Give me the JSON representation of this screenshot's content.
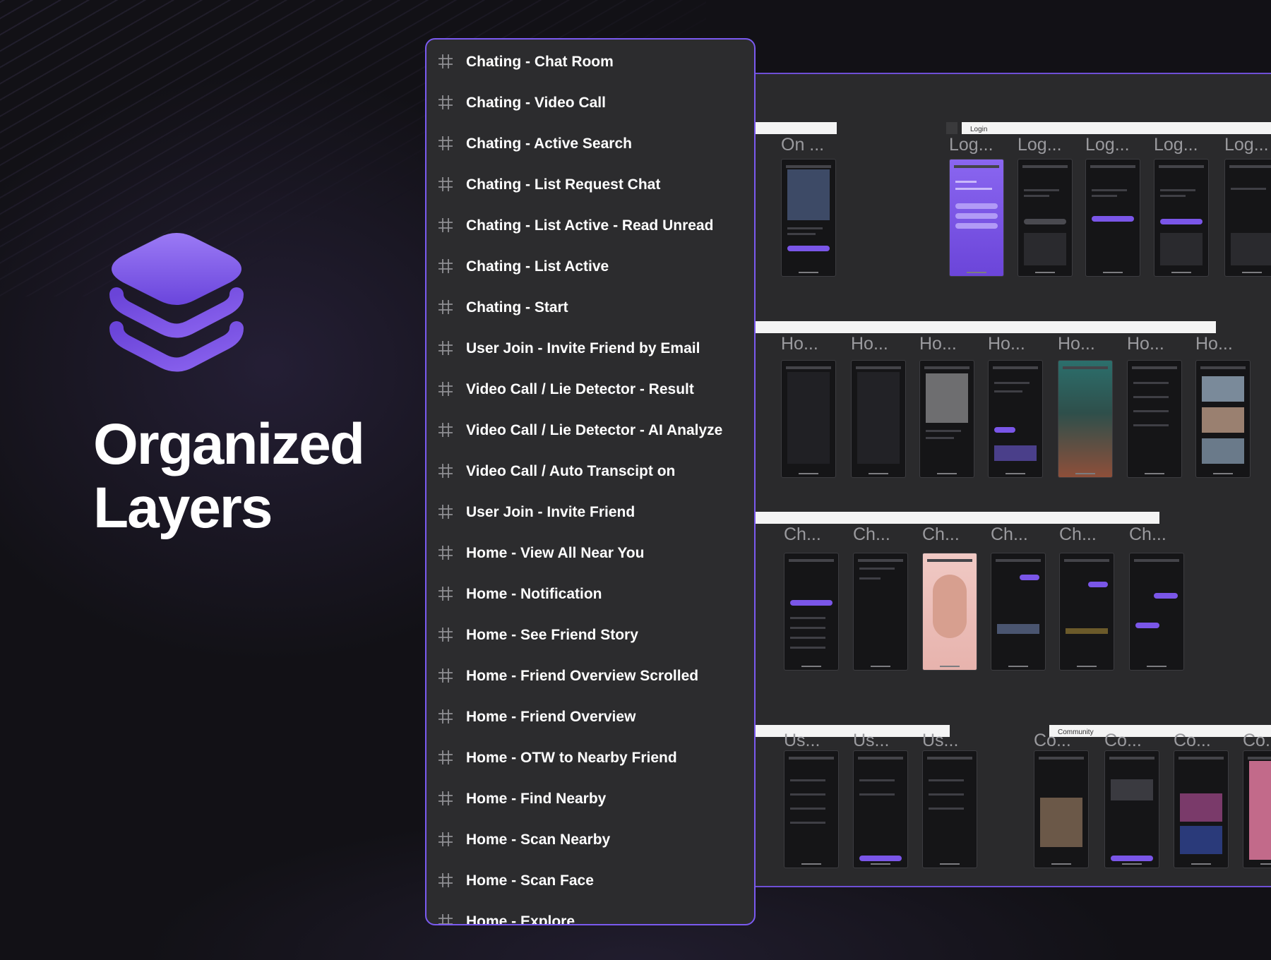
{
  "headline": {
    "line1": "Organized",
    "line2": "Layers"
  },
  "layers": [
    {
      "label": "Chating - Chat Room",
      "icon": "frame-hash-icon"
    },
    {
      "label": "Chating - Video Call",
      "icon": "frame-hash-icon"
    },
    {
      "label": "Chating - Active Search",
      "icon": "frame-hash-icon"
    },
    {
      "label": "Chating - List Request Chat",
      "icon": "frame-hash-icon"
    },
    {
      "label": "Chating - List Active - Read Unread",
      "icon": "frame-hash-icon"
    },
    {
      "label": "Chating - List Active",
      "icon": "frame-hash-icon"
    },
    {
      "label": "Chating - Start",
      "icon": "frame-hash-icon"
    },
    {
      "label": "User Join - Invite Friend by Email",
      "icon": "frame-hash-icon"
    },
    {
      "label": "Video Call / Lie Detector - Result",
      "icon": "frame-hash-icon"
    },
    {
      "label": "Video Call / Lie Detector - AI Analyze",
      "icon": "frame-hash-icon"
    },
    {
      "label": "Video Call / Auto Transcipt on",
      "icon": "frame-hash-icon"
    },
    {
      "label": "User Join - Invite Friend",
      "icon": "frame-hash-icon"
    },
    {
      "label": "Home - View All Near You",
      "icon": "frame-hash-icon"
    },
    {
      "label": "Home - Notification",
      "icon": "frame-hash-icon"
    },
    {
      "label": "Home - See Friend Story",
      "icon": "frame-hash-icon"
    },
    {
      "label": "Home - Friend Overview Scrolled",
      "icon": "frame-hash-icon"
    },
    {
      "label": "Home - Friend Overview",
      "icon": "frame-hash-icon"
    },
    {
      "label": "Home - OTW to Nearby Friend",
      "icon": "frame-hash-icon"
    },
    {
      "label": "Home - Find Nearby",
      "icon": "frame-hash-icon"
    },
    {
      "label": "Home - Scan Nearby",
      "icon": "frame-hash-icon"
    },
    {
      "label": "Home - Scan Face",
      "icon": "frame-hash-icon"
    },
    {
      "label": "Home - Explore",
      "icon": "frame-hash-icon"
    }
  ],
  "canvas": {
    "section_labels": [
      "Login",
      "Community"
    ],
    "row1": [
      "On ...",
      "Log...",
      "Log...",
      "Log...",
      "Log...",
      "Log..."
    ],
    "row2": [
      "Ho...",
      "Ho...",
      "Ho...",
      "Ho...",
      "Ho...",
      "Ho...",
      "Ho..."
    ],
    "row3": [
      "Ch...",
      "Ch...",
      "Ch...",
      "Ch...",
      "Ch...",
      "Ch..."
    ],
    "row4": [
      "Us...",
      "Us...",
      "Us...",
      "Co...",
      "Co...",
      "Co...",
      "Co..."
    ]
  },
  "colors": {
    "accent": "#7a5af0",
    "background": "#121116",
    "panel": "#2c2c2e"
  }
}
